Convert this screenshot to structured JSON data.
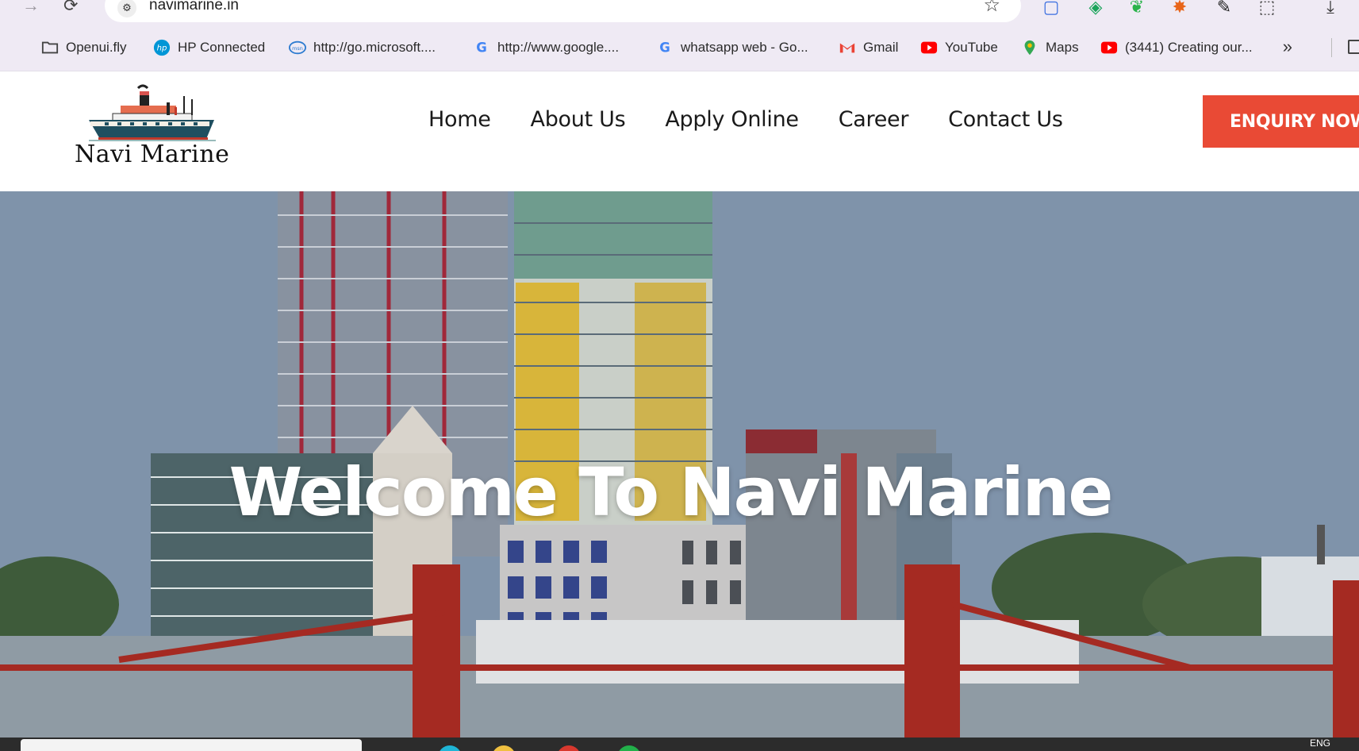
{
  "browser": {
    "url": "navimarine.in",
    "bookmarks": [
      {
        "label": "Openui.fly",
        "icon": "folder-icon"
      },
      {
        "label": "HP Connected",
        "icon": "hp-icon"
      },
      {
        "label": "http://go.microsoft....",
        "icon": "msn-icon"
      },
      {
        "label": "http://www.google....",
        "icon": "google-icon"
      },
      {
        "label": "whatsapp web - Go...",
        "icon": "google-icon"
      },
      {
        "label": "Gmail",
        "icon": "gmail-icon"
      },
      {
        "label": "YouTube",
        "icon": "youtube-icon"
      },
      {
        "label": "Maps",
        "icon": "maps-icon"
      },
      {
        "label": "(3441) Creating our...",
        "icon": "youtube-icon"
      }
    ]
  },
  "site": {
    "logo_text": "Navi Marine",
    "nav": [
      "Home",
      "About Us",
      "Apply Online",
      "Career",
      "Contact Us"
    ],
    "cta": "ENQUIRY NOW",
    "hero_title": "Welcome To Navi Marine"
  },
  "taskbar": {
    "language": "ENG"
  },
  "colors": {
    "accent": "#e94a35",
    "browser_chrome": "#efeaf4"
  }
}
